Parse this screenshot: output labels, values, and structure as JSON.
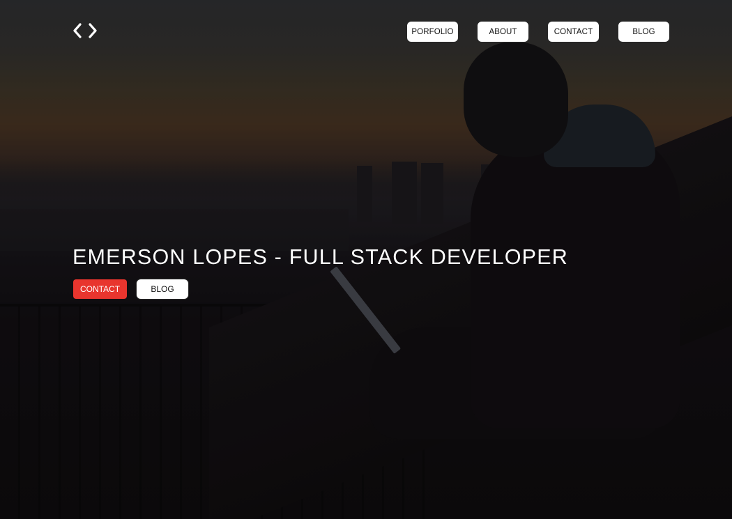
{
  "header": {
    "logo_icon": "code-brackets-icon",
    "nav": [
      {
        "label": "PORFOLIO"
      },
      {
        "label": "ABOUT"
      },
      {
        "label": "CONTACT"
      },
      {
        "label": "BLOG"
      }
    ]
  },
  "hero": {
    "title": "EMERSON LOPES - FULL STACK DEVELOPER",
    "contact_label": "CONTACT",
    "blog_label": "BLOG"
  },
  "colors": {
    "accent": "#e8352e",
    "text": "#ffffff",
    "button_bg": "#ffffff"
  }
}
